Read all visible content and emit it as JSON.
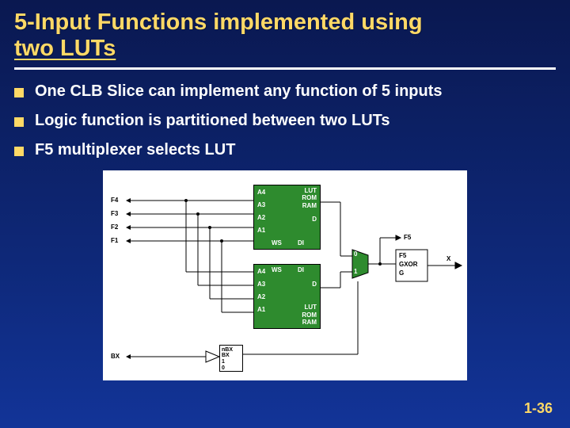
{
  "title_line1": "5-Input Functions implemented using",
  "title_line2": "two LUTs",
  "bullets": [
    "One CLB Slice can implement any function of 5 inputs",
    "Logic function is partitioned between two LUTs",
    "F5 multiplexer selects LUT"
  ],
  "diagram": {
    "lut_modes": "LUT\nROM\nRAM",
    "lut_inputs": [
      "A4",
      "A3",
      "A2",
      "A1"
    ],
    "lut_ws": "WS",
    "lut_di": "DI",
    "lut_d": "D",
    "left_inputs": [
      "F4",
      "F3",
      "F2",
      "F1"
    ],
    "bx_input": "BX",
    "bx_box": [
      "nBX",
      "BX",
      "1",
      "0"
    ],
    "f5_label": "F5",
    "out_sig": "X",
    "out_stack": [
      "F5",
      "GXOR",
      "G"
    ],
    "mux_in": [
      "0",
      "1"
    ]
  },
  "page_number": "1-36"
}
